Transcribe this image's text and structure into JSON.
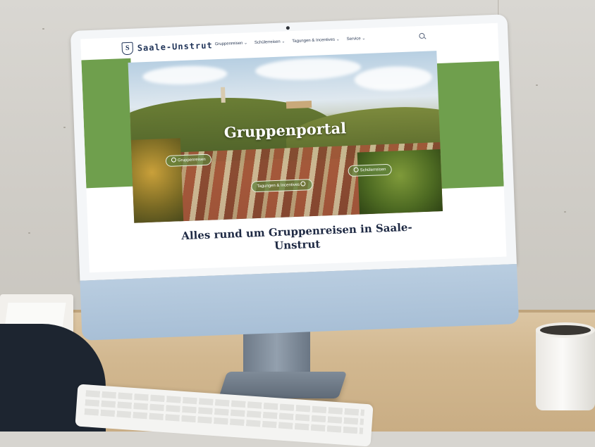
{
  "site": {
    "logo_mark": "S",
    "logo_text": "Saale-Unstrut",
    "menu": [
      {
        "label": "Gruppenreisen ⌄"
      },
      {
        "label": "Schülerreisen ⌄"
      },
      {
        "label": "Tagungen & Incentives ⌄"
      },
      {
        "label": "Service ⌄"
      }
    ],
    "search_icon": "search-icon"
  },
  "hero": {
    "title": "Gruppenportal",
    "buttons": [
      {
        "label": "Gruppenreisen"
      },
      {
        "label": "Tagungen & Incentives"
      },
      {
        "label": "Schülerreisen"
      }
    ]
  },
  "headline": {
    "line1": "Alles rund um Gruppenreisen in Saale-",
    "line2": "Unstrut"
  },
  "colors": {
    "brand_green": "#6f9f4d",
    "brand_navy": "#1f3358",
    "monitor_chin": "#b9cde0"
  }
}
